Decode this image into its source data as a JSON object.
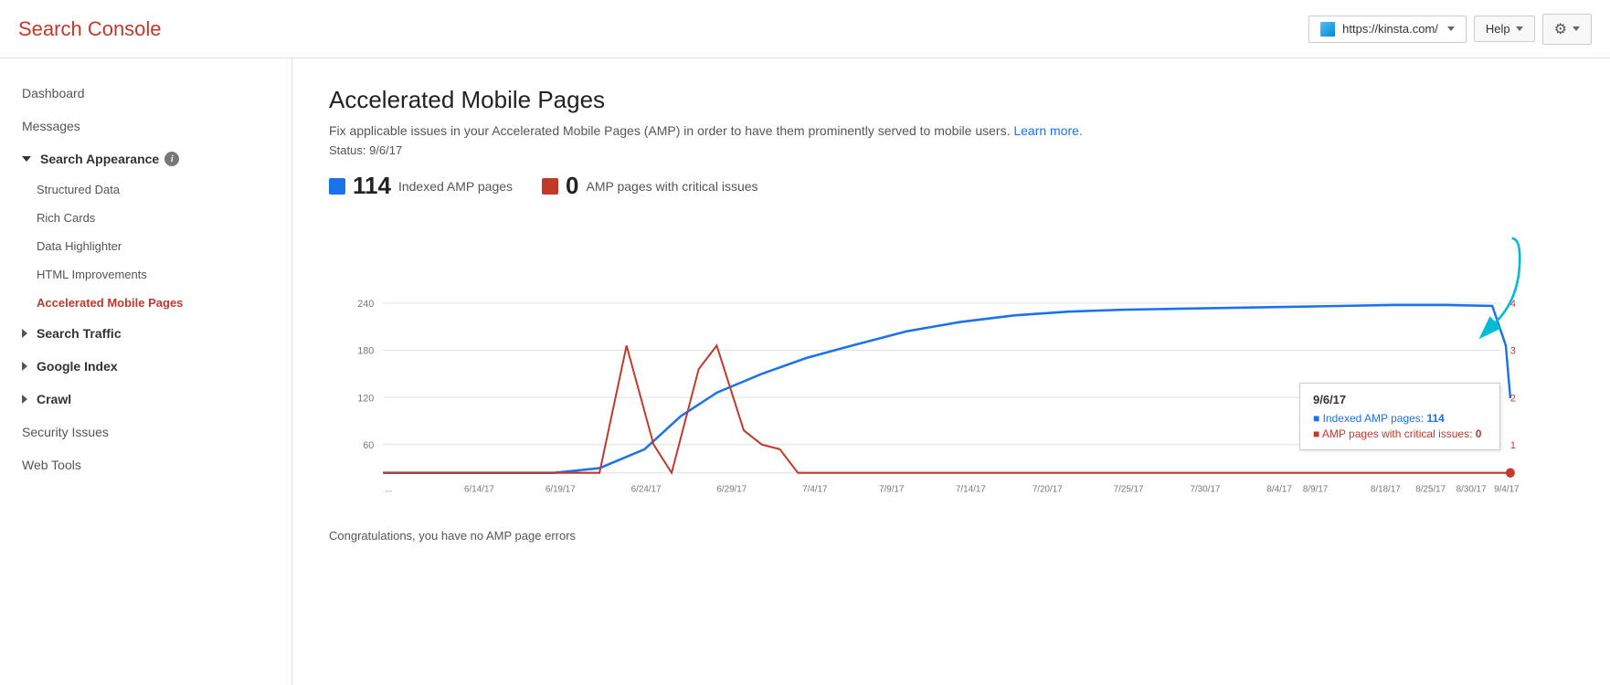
{
  "header": {
    "logo": "Search Console",
    "site_url": "https://kinsta.com/",
    "help_label": "Help",
    "settings_icon": "⚙"
  },
  "sidebar": {
    "dashboard_label": "Dashboard",
    "messages_label": "Messages",
    "search_appearance": {
      "label": "Search Appearance",
      "items": [
        {
          "id": "structured-data",
          "label": "Structured Data",
          "active": false
        },
        {
          "id": "rich-cards",
          "label": "Rich Cards",
          "active": false
        },
        {
          "id": "data-highlighter",
          "label": "Data Highlighter",
          "active": false
        },
        {
          "id": "html-improvements",
          "label": "HTML Improvements",
          "active": false
        },
        {
          "id": "amp",
          "label": "Accelerated Mobile Pages",
          "active": true
        }
      ]
    },
    "search_traffic_label": "Search Traffic",
    "google_index_label": "Google Index",
    "crawl_label": "Crawl",
    "security_issues_label": "Security Issues",
    "web_tools_label": "Web Tools"
  },
  "main": {
    "title": "Accelerated Mobile Pages",
    "description": "Fix applicable issues in your Accelerated Mobile Pages (AMP) in order to have them prominently served to mobile users.",
    "learn_more": "Learn more.",
    "status": "Status: 9/6/17",
    "indexed_count": "114",
    "indexed_label": "Indexed AMP pages",
    "critical_count": "0",
    "critical_label": "AMP pages with critical issues",
    "tooltip": {
      "date": "9/6/17",
      "blue_label": "Indexed AMP pages:",
      "blue_value": "114",
      "red_label": "AMP pages with critical issues:",
      "red_value": "0"
    },
    "congratulations": "Congratulations, you have no AMP page errors",
    "chart": {
      "y_labels": [
        "60",
        "120",
        "180",
        "240"
      ],
      "y_labels_right": [
        "1",
        "2",
        "3",
        "4"
      ],
      "x_labels": [
        "...",
        "6/14/17",
        "6/19/17",
        "6/24/17",
        "6/29/17",
        "7/4/17",
        "7/9/17",
        "7/14/17",
        "7/20/17",
        "7/25/17",
        "7/30/17",
        "8/4/17",
        "8/9/17",
        "8/18/17",
        "8/25/17",
        "8/30/17",
        "9/4/17"
      ]
    }
  }
}
